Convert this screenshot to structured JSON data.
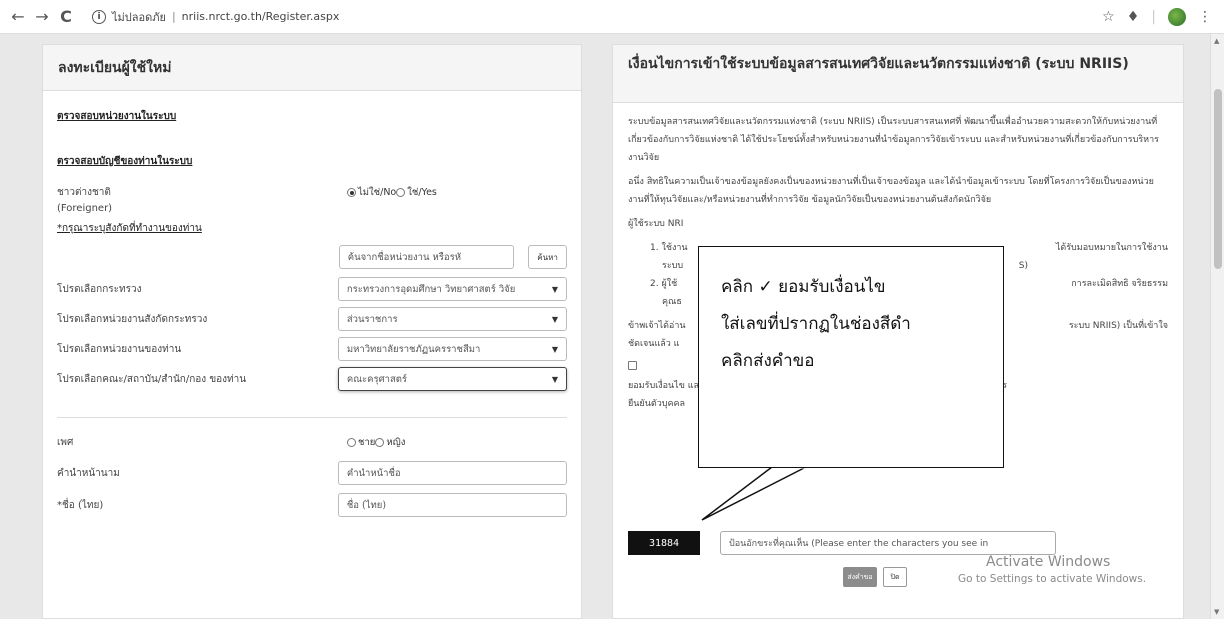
{
  "browser": {
    "back": "←",
    "forward": "→",
    "reload": "C",
    "security_label": "ไม่ปลอดภัย",
    "url": "nriis.nrct.go.th/Register.aspx"
  },
  "left": {
    "title": "ลงทะเบียนผู้ใช้ใหม่",
    "check_unit": "ตรวจสอบหน่วยงานในระบบ",
    "check_account": "ตรวจสอบบัญชีของท่านในระบบ",
    "foreigner_label": "ชาวต่างชาติ",
    "foreigner_label_en": "(Foreigner)",
    "foreigner_no": "ไม่ใช่/No",
    "foreigner_yes": "ใช่/Yes",
    "affiliation_note": "*กรุณาระบุสังกัดที่ทำงานของท่าน",
    "search_placeholder": "ค้นจากชื่อหน่วยงาน หรือรหั",
    "search_button": "ค้นหา",
    "ministry_label": "โปรดเลือกกระทรวง",
    "ministry_value": "กระทรวงการอุดมศึกษา วิทยาศาสตร์ วิจัย",
    "dept_label": "โปรดเลือกหน่วยงานสังกัดกระทรวง",
    "dept_value": "ส่วนราชการ",
    "unit_label": "โปรดเลือกหน่วยงานของท่าน",
    "unit_value": "มหาวิทยาลัยราชภัฏนครราชสีมา",
    "faculty_label": "โปรดเลือกคณะ/สถาบัน/สำนัก/กอง ของท่าน",
    "faculty_value": "คณะครุศาสตร์",
    "gender_label": "เพศ",
    "gender_male": "ชาย",
    "gender_female": "หญิง",
    "prefix_label": "คำนำหน้านาม",
    "prefix_placeholder": "คำนำหน้าชื่อ",
    "name_label": "*ชื่อ (ไทย)",
    "name_placeholder": "ชื่อ (ไทย)"
  },
  "right": {
    "title": "เงื่อนไขการเข้าใช้ระบบข้อมูลสารสนเทศวิจัยและนวัตกรรมแห่งชาติ (ระบบ NRIIS)",
    "p1": "ระบบข้อมูลสารสนเทศวิจัยและนวัตกรรมแห่งชาติ (ระบบ NRIIS) เป็นระบบสารสนเทศที่ พัฒนาขึ้นเพื่ออำนวยความสะดวกให้กับหน่วยงานที่เกี่ยวข้องกับการวิจัยแห่งชาติ ได้ใช้ประโยชน์ทั้งสำหรับหน่วยงานที่นำข้อมูลการวิจัยเข้าระบบ และสำหรับหน่วยงานที่เกี่ยวข้องกับการบริหารงานวิจัย",
    "p2": "อนึ่ง สิทธิในความเป็นเจ้าของข้อมูลยังคงเป็นของหน่วยงานที่เป็นเจ้าของข้อมูล และได้นำข้อมูลเข้าระบบ โดยที่โครงการวิจัยเป็นของหน่วยงานที่ให้ทุนวิจัยและ/หรือหน่วยงานที่ทำการวิจัย ข้อมูลนักวิจัยเป็นของหน่วยงานต้นสังกัดนักวิจัย",
    "p3_start": "ผู้ใช้ระบบ NRI",
    "li1_start": "ใช้งาน",
    "li1_end": "ได้รับมอบหมายในการใช้งาน",
    "li1_line2": "ระบบ",
    "li1_line2_end": "S)",
    "li2_start": "ผู้ใช้",
    "li2_end": "การละเมิดสิทธิ จริยธรรม",
    "li2_line2": "คุณธ",
    "p4_start": "ข้าพเจ้าได้อ่าน",
    "p4_end": "ระบบ NRIIS) เป็นที่เข้าใจ",
    "p4_line2": "ชัดเจนแล้ว แ",
    "consent": "ยอมรับเงื่อนไข และให้ วช. ตรวจสอบข้อมูลของท่าน ในฐานข้อมูลของกรมการปกครอง เพื่อเป็นการ",
    "consent_line2": "ยืนยันตัวบุคคล",
    "captcha_code": "31884",
    "captcha_placeholder": "ป้อนอักขระที่คุณเห็น (Please enter the characters you see in",
    "submit": "ส่งคำขอ",
    "cancel": "ปิด"
  },
  "callout": {
    "line1": "คลิก ✓ ยอมรับเงื่อนไข",
    "line2": "ใส่เลขที่ปรากฏในช่องสีดำ",
    "line3": "คลิกส่งคำขอ"
  },
  "watermark": {
    "line1": "Activate Windows",
    "line2": "Go to Settings to activate Windows."
  }
}
